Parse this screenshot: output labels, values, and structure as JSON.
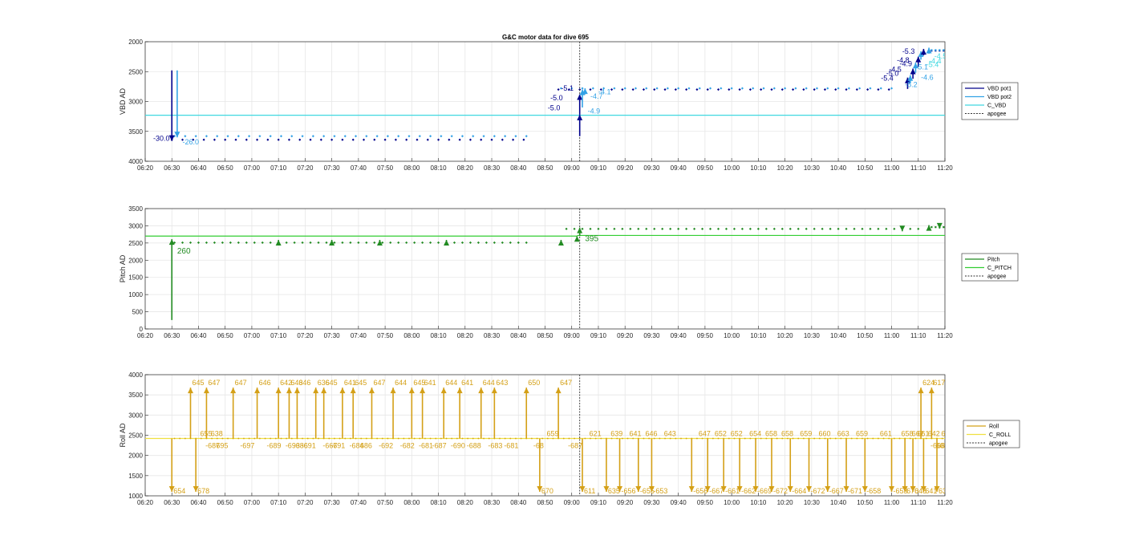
{
  "figure_title": "G&C motor data for dive 695",
  "chart_data": [
    {
      "type": "line",
      "id": "vbd",
      "ylabel": "VBD AD",
      "ylim": [
        2000,
        4000
      ],
      "y_reversed": true,
      "yticks": [
        2000,
        2500,
        3000,
        3500,
        4000
      ],
      "xlim": [
        "06:20",
        "11:20"
      ],
      "xticks": [
        "06:20",
        "06:30",
        "06:40",
        "06:50",
        "07:00",
        "07:10",
        "07:20",
        "07:30",
        "07:40",
        "07:50",
        "08:00",
        "08:10",
        "08:20",
        "08:30",
        "08:40",
        "08:50",
        "09:00",
        "09:10",
        "09:20",
        "09:30",
        "09:40",
        "09:50",
        "10:00",
        "10:10",
        "10:20",
        "10:30",
        "10:40",
        "10:50",
        "11:00",
        "11:10",
        "11:20"
      ],
      "grid": true,
      "legend": [
        "VBD pot1",
        "VBD pot2",
        "C_VBD",
        "apogee"
      ],
      "legend_placement": "outside-right",
      "series": [
        {
          "name": "VBD pot1",
          "color": "#00008b",
          "x_start": "06:30",
          "x_end": "11:10",
          "level_segments": [
            [
              390,
              3640
            ],
            [
              523,
              3640
            ],
            [
              535,
              2800
            ],
            [
              660,
              2800
            ],
            [
              675,
              2150
            ]
          ],
          "marker_step": 4
        },
        {
          "name": "VBD pot2",
          "color": "#33a2e6",
          "x_start": "06:31",
          "x_end": "11:10",
          "level_segments": [
            [
              391,
              3580
            ],
            [
              523,
              3580
            ],
            [
              536,
              2780
            ],
            [
              660,
              2780
            ],
            [
              675,
              2140
            ]
          ],
          "marker_step": 4
        },
        {
          "name": "C_VBD",
          "color": "#40d8e0",
          "y": 3230
        }
      ],
      "apogee": "09:03",
      "arrows": [
        {
          "x": "06:30",
          "y0": 2480,
          "y1": 3660,
          "color": "#00008b"
        },
        {
          "x": "06:32",
          "y0": 2480,
          "y1": 3600,
          "color": "#33a2e6"
        },
        {
          "x": "09:03",
          "y0": 3580,
          "y1": 3220,
          "color": "#00008b"
        },
        {
          "x": "09:03",
          "y0": 3220,
          "y1": 2880,
          "color": "#00008b"
        },
        {
          "x": "09:04",
          "y0": 3100,
          "y1": 2800,
          "color": "#33a2e6"
        },
        {
          "x": "09:05",
          "y0": 2880,
          "y1": 2780,
          "color": "#33a2e6"
        },
        {
          "x": "11:06",
          "y0": 2790,
          "y1": 2600,
          "color": "#00008b"
        },
        {
          "x": "11:07",
          "y0": 2700,
          "y1": 2560,
          "color": "#33a2e6"
        },
        {
          "x": "11:08",
          "y0": 2620,
          "y1": 2450,
          "color": "#00008b"
        },
        {
          "x": "11:09",
          "y0": 2520,
          "y1": 2350,
          "color": "#33a2e6"
        },
        {
          "x": "11:10",
          "y0": 2420,
          "y1": 2250,
          "color": "#00008b"
        },
        {
          "x": "11:11",
          "y0": 2300,
          "y1": 2160,
          "color": "#33a2e6"
        },
        {
          "x": "11:12",
          "y0": 2230,
          "y1": 2120,
          "color": "#00008b"
        },
        {
          "x": "11:14",
          "y0": 2200,
          "y1": 2100,
          "color": "#33a2e6"
        }
      ],
      "labels": [
        {
          "text": "-30.0",
          "x": "06:23",
          "y": 3660,
          "color": "#00008b",
          "size": 9
        },
        {
          "text": "-26.0",
          "x": "06:34",
          "y": 3720,
          "color": "#33a2e6",
          "size": 9
        },
        {
          "text": "-5.0",
          "x": "08:51",
          "y": 3150,
          "color": "#00008b",
          "size": 9
        },
        {
          "text": "-4.9",
          "x": "09:06",
          "y": 3200,
          "color": "#33a2e6",
          "size": 9
        },
        {
          "text": "-5.0",
          "x": "08:52",
          "y": 2980,
          "color": "#00008b",
          "size": 9
        },
        {
          "text": "-5.1",
          "x": "08:56",
          "y": 2820,
          "color": "#00008b",
          "size": 9
        },
        {
          "text": "-4.7",
          "x": "09:07",
          "y": 2950,
          "color": "#33a2e6",
          "size": 9
        },
        {
          "text": "-4.1",
          "x": "09:10",
          "y": 2880,
          "color": "#33a2e6",
          "size": 9
        },
        {
          "text": "-5.3",
          "x": "11:04",
          "y": 2200,
          "color": "#00008b",
          "size": 9
        },
        {
          "text": "-4.8",
          "x": "11:02",
          "y": 2350,
          "color": "#00008b",
          "size": 9
        },
        {
          "text": "-4.9",
          "x": "11:03",
          "y": 2410,
          "color": "#00008b",
          "size": 9
        },
        {
          "text": "-4.5",
          "x": "10:59",
          "y": 2500,
          "color": "#00008b",
          "size": 9
        },
        {
          "text": "-5.0",
          "x": "10:58",
          "y": 2570,
          "color": "#00008b",
          "size": 9
        },
        {
          "text": "-5.4",
          "x": "10:56",
          "y": 2650,
          "color": "#00008b",
          "size": 9
        },
        {
          "text": "-4.5",
          "x": "11:16",
          "y": 2280,
          "color": "#40d8e0",
          "size": 9
        },
        {
          "text": "-5.4",
          "x": "11:13",
          "y": 2420,
          "color": "#40d8e0",
          "size": 9
        },
        {
          "text": "-4.4",
          "x": "11:14",
          "y": 2360,
          "color": "#40d8e0",
          "size": 9
        },
        {
          "text": "-5.1",
          "x": "11:09",
          "y": 2460,
          "color": "#33a2e6",
          "size": 9
        },
        {
          "text": "-4.6",
          "x": "11:11",
          "y": 2640,
          "color": "#33a2e6",
          "size": 9
        },
        {
          "text": "-5.2",
          "x": "11:05",
          "y": 2760,
          "color": "#33a2e6",
          "size": 9
        }
      ]
    },
    {
      "type": "line",
      "id": "pitch",
      "ylabel": "Pitch AD",
      "ylim": [
        0,
        3500
      ],
      "y_reversed": false,
      "yticks": [
        0,
        500,
        1000,
        1500,
        2000,
        2500,
        3000,
        3500
      ],
      "xlim": [
        "06:20",
        "11:20"
      ],
      "grid": true,
      "legend": [
        "Pitch",
        "C_PITCH",
        "apogee"
      ],
      "legend_placement": "outside-right",
      "series": [
        {
          "name": "Pitch",
          "color": "#228b22",
          "x_start": "06:31",
          "x_end": "11:18",
          "level_segments": [
            [
              391,
              2510
            ],
            [
              523,
              2510
            ],
            [
              538,
              2910
            ],
            [
              670,
              2910
            ],
            [
              675,
              2960
            ]
          ],
          "marker_step": 3
        },
        {
          "name": "C_PITCH",
          "color": "#32cd32",
          "segments": [
            [
              "06:20",
              "09:02",
              2700
            ],
            [
              "09:02",
              "11:20",
              2720
            ]
          ]
        }
      ],
      "apogee": "09:03",
      "arrows": [
        {
          "x": "06:30",
          "y0": 260,
          "y1": 2610,
          "color": "#228b22"
        },
        {
          "x": "07:10",
          "y0": 2480,
          "y1": 2590,
          "color": "#228b22"
        },
        {
          "x": "07:30",
          "y0": 2480,
          "y1": 2590,
          "color": "#228b22"
        },
        {
          "x": "07:48",
          "y0": 2480,
          "y1": 2590,
          "color": "#228b22"
        },
        {
          "x": "08:13",
          "y0": 2480,
          "y1": 2590,
          "color": "#228b22"
        },
        {
          "x": "08:56",
          "y0": 2480,
          "y1": 2590,
          "color": "#228b22"
        },
        {
          "x": "09:02",
          "y0": 2560,
          "y1": 2700,
          "color": "#228b22"
        },
        {
          "x": "09:03",
          "y0": 2700,
          "y1": 2950,
          "color": "#228b22"
        },
        {
          "x": "11:04",
          "y0": 2940,
          "y1": 2840,
          "color": "#228b22"
        },
        {
          "x": "11:14",
          "y0": 2900,
          "y1": 3020,
          "color": "#228b22"
        },
        {
          "x": "11:18",
          "y0": 3020,
          "y1": 2920,
          "color": "#228b22"
        }
      ],
      "labels": [
        {
          "text": "260",
          "x": "06:32",
          "y": 2190,
          "color": "#228b22",
          "size": 10
        },
        {
          "text": "395",
          "x": "09:05",
          "y": 2560,
          "color": "#228b22",
          "size": 10
        }
      ]
    },
    {
      "type": "line",
      "id": "roll",
      "ylabel": "Roll AD",
      "ylim": [
        1000,
        4000
      ],
      "y_reversed": false,
      "yticks": [
        1000,
        1500,
        2000,
        2500,
        3000,
        3500,
        4000
      ],
      "xlim": [
        "06:20",
        "11:20"
      ],
      "grid": true,
      "legend": [
        "Roll",
        "C_ROLL",
        "apogee"
      ],
      "legend_placement": "outside-right",
      "series": [
        {
          "name": "Roll",
          "color": "#d4a017",
          "y": 2420,
          "x_start": "06:31",
          "x_end": "11:20",
          "marker_step": 2
        },
        {
          "name": "C_ROLL",
          "color": "#f0e040",
          "y": 2420
        }
      ],
      "apogee": "09:03",
      "roll_events": [
        {
          "x": "06:30",
          "dir": "down",
          "label": "654"
        },
        {
          "x": "06:37",
          "dir": "up",
          "label": "645"
        },
        {
          "x": "06:39",
          "dir": "down",
          "label": "678"
        },
        {
          "x": "06:40",
          "dir": "mid",
          "label": "655"
        },
        {
          "x": "06:43",
          "dir": "up",
          "label": "647"
        },
        {
          "x": "06:44",
          "dir": "mid",
          "label": "638"
        },
        {
          "x": "06:42",
          "dir": "mid-low",
          "label": "-687"
        },
        {
          "x": "06:46",
          "dir": "mid-low",
          "label": "695"
        },
        {
          "x": "06:53",
          "dir": "up",
          "label": "647"
        },
        {
          "x": "06:55",
          "dir": "mid-low",
          "label": "-697"
        },
        {
          "x": "07:02",
          "dir": "up",
          "label": "646"
        },
        {
          "x": "07:05",
          "dir": "mid-low",
          "label": "-689"
        },
        {
          "x": "07:10",
          "dir": "up",
          "label": "642"
        },
        {
          "x": "07:12",
          "dir": "mid-low",
          "label": "-693"
        },
        {
          "x": "07:14",
          "dir": "up",
          "label": "643"
        },
        {
          "x": "07:15",
          "dir": "mid-low",
          "label": "-686"
        },
        {
          "x": "07:17",
          "dir": "up",
          "label": "646"
        },
        {
          "x": "07:18",
          "dir": "mid-low",
          "label": "-691"
        },
        {
          "x": "07:24",
          "dir": "up",
          "label": "636"
        },
        {
          "x": "07:27",
          "dir": "up",
          "label": "645"
        },
        {
          "x": "07:26",
          "dir": "mid-low",
          "label": "-667"
        },
        {
          "x": "07:29",
          "dir": "mid-low",
          "label": "-691"
        },
        {
          "x": "07:34",
          "dir": "up",
          "label": "641"
        },
        {
          "x": "07:38",
          "dir": "up",
          "label": "645"
        },
        {
          "x": "07:36",
          "dir": "mid-low",
          "label": "-684"
        },
        {
          "x": "07:40",
          "dir": "mid-low",
          "label": "686"
        },
        {
          "x": "07:45",
          "dir": "up",
          "label": "647"
        },
        {
          "x": "07:47",
          "dir": "mid-low",
          "label": "-692"
        },
        {
          "x": "07:53",
          "dir": "up",
          "label": "644"
        },
        {
          "x": "07:55",
          "dir": "mid-low",
          "label": "-682"
        },
        {
          "x": "08:00",
          "dir": "up",
          "label": "645"
        },
        {
          "x": "08:04",
          "dir": "up",
          "label": "641"
        },
        {
          "x": "08:02",
          "dir": "mid-low",
          "label": "-681"
        },
        {
          "x": "08:07",
          "dir": "mid-low",
          "label": "-687"
        },
        {
          "x": "08:12",
          "dir": "up",
          "label": "644"
        },
        {
          "x": "08:14",
          "dir": "mid-low",
          "label": "-690"
        },
        {
          "x": "08:18",
          "dir": "up",
          "label": "641"
        },
        {
          "x": "08:20",
          "dir": "mid-low",
          "label": "-688"
        },
        {
          "x": "08:26",
          "dir": "up",
          "label": "644"
        },
        {
          "x": "08:28",
          "dir": "mid-low",
          "label": "-683"
        },
        {
          "x": "08:31",
          "dir": "up",
          "label": "643"
        },
        {
          "x": "08:34",
          "dir": "mid-low",
          "label": "-681"
        },
        {
          "x": "08:43",
          "dir": "up",
          "label": "650"
        },
        {
          "x": "08:45",
          "dir": "mid-low",
          "label": "-68"
        },
        {
          "x": "08:48",
          "dir": "down",
          "label": "670"
        },
        {
          "x": "08:50",
          "dir": "mid",
          "label": "659"
        },
        {
          "x": "08:55",
          "dir": "up",
          "label": "647"
        },
        {
          "x": "08:58",
          "dir": "mid-low",
          "label": "-687"
        },
        {
          "x": "09:04",
          "dir": "down",
          "label": "611"
        },
        {
          "x": "09:06",
          "dir": "mid",
          "label": "621"
        },
        {
          "x": "09:13",
          "dir": "down",
          "label": "635"
        },
        {
          "x": "09:14",
          "dir": "mid",
          "label": "639"
        },
        {
          "x": "09:18",
          "dir": "down",
          "label": "-656"
        },
        {
          "x": "09:21",
          "dir": "mid",
          "label": "641"
        },
        {
          "x": "09:25",
          "dir": "down",
          "label": "-655"
        },
        {
          "x": "09:27",
          "dir": "mid",
          "label": "646"
        },
        {
          "x": "09:30",
          "dir": "down",
          "label": "-653"
        },
        {
          "x": "09:34",
          "dir": "mid",
          "label": "643"
        },
        {
          "x": "09:45",
          "dir": "down",
          "label": "-656"
        },
        {
          "x": "09:47",
          "dir": "mid",
          "label": "647"
        },
        {
          "x": "09:51",
          "dir": "down",
          "label": "-667"
        },
        {
          "x": "09:53",
          "dir": "mid",
          "label": "652"
        },
        {
          "x": "09:57",
          "dir": "down",
          "label": "-661"
        },
        {
          "x": "09:59",
          "dir": "mid",
          "label": "652"
        },
        {
          "x": "10:03",
          "dir": "down",
          "label": "-662"
        },
        {
          "x": "10:06",
          "dir": "mid",
          "label": "654"
        },
        {
          "x": "10:09",
          "dir": "down",
          "label": "-669"
        },
        {
          "x": "10:12",
          "dir": "mid",
          "label": "658"
        },
        {
          "x": "10:15",
          "dir": "down",
          "label": "-672"
        },
        {
          "x": "10:18",
          "dir": "mid",
          "label": "658"
        },
        {
          "x": "10:22",
          "dir": "down",
          "label": "-664"
        },
        {
          "x": "10:25",
          "dir": "mid",
          "label": "659"
        },
        {
          "x": "10:29",
          "dir": "down",
          "label": "-672"
        },
        {
          "x": "10:32",
          "dir": "mid",
          "label": "660"
        },
        {
          "x": "10:36",
          "dir": "down",
          "label": "-667"
        },
        {
          "x": "10:39",
          "dir": "mid",
          "label": "663"
        },
        {
          "x": "10:43",
          "dir": "down",
          "label": "-671"
        },
        {
          "x": "10:46",
          "dir": "mid",
          "label": "659"
        },
        {
          "x": "10:50",
          "dir": "down",
          "label": "-658"
        },
        {
          "x": "10:55",
          "dir": "mid",
          "label": "661"
        },
        {
          "x": "11:00",
          "dir": "down",
          "label": "-653"
        },
        {
          "x": "11:03",
          "dir": "mid",
          "label": "658"
        },
        {
          "x": "11:05",
          "dir": "down",
          "label": "670"
        },
        {
          "x": "11:07",
          "dir": "mid",
          "label": "662"
        },
        {
          "x": "11:08",
          "dir": "down",
          "label": "648"
        },
        {
          "x": "11:09",
          "dir": "mid",
          "label": "661"
        },
        {
          "x": "11:11",
          "dir": "up",
          "label": "624"
        },
        {
          "x": "11:12",
          "dir": "down",
          "label": "641"
        },
        {
          "x": "11:13",
          "dir": "mid",
          "label": "642"
        },
        {
          "x": "11:14",
          "dir": "mid-low",
          "label": "-668"
        },
        {
          "x": "11:15",
          "dir": "up",
          "label": "617"
        },
        {
          "x": "11:16",
          "dir": "mid-low",
          "label": "661"
        },
        {
          "x": "11:17",
          "dir": "down",
          "label": "630"
        },
        {
          "x": "11:18",
          "dir": "mid",
          "label": "647"
        }
      ]
    }
  ]
}
